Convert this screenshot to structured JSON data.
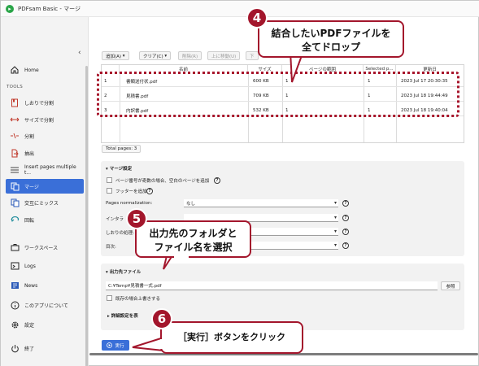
{
  "window": {
    "title": "PDFsam Basic - マージ"
  },
  "sidebar": {
    "home": "Home",
    "tools_header": "TOOLS",
    "items": [
      {
        "label": "しおりで分割",
        "icon": "split-bookmark-icon"
      },
      {
        "label": "サイズで分割",
        "icon": "split-size-icon"
      },
      {
        "label": "分割",
        "icon": "split-icon"
      },
      {
        "label": "抽出",
        "icon": "extract-icon"
      },
      {
        "label": "Insert pages multiple t...",
        "icon": "insert-pages-icon"
      },
      {
        "label": "マージ",
        "icon": "merge-icon"
      },
      {
        "label": "交互にミックス",
        "icon": "alternate-mix-icon"
      },
      {
        "label": "回転",
        "icon": "rotate-icon"
      }
    ],
    "bottom": [
      {
        "label": "ワークスペース",
        "icon": "briefcase-icon"
      },
      {
        "label": "Logs",
        "icon": "logs-icon"
      },
      {
        "label": "News",
        "icon": "news-icon"
      },
      {
        "label": "このアプリについて",
        "icon": "info-icon"
      },
      {
        "label": "設定",
        "icon": "gear-icon"
      },
      {
        "label": "終了",
        "icon": "power-icon"
      }
    ]
  },
  "toolbar": {
    "add": "追加(A)",
    "clear": "クリア(C)",
    "delete": "削除(R)",
    "move_up": "上に移動(U)",
    "move_down": "下"
  },
  "table": {
    "columns": [
      "名前",
      "サイズ",
      "ページの範囲",
      "Selected p...",
      "更新日"
    ],
    "rows": [
      {
        "num": "1",
        "name": "書類送付状.pdf",
        "size": "600 KB",
        "pages": "1",
        "selected": "1",
        "modified": "2023 Jul 17 20:30:35"
      },
      {
        "num": "2",
        "name": "見積書.pdf",
        "size": "709 KB",
        "pages": "1",
        "selected": "1",
        "modified": "2023 Jul 18 19:44:49"
      },
      {
        "num": "3",
        "name": "内訳書.pdf",
        "size": "532 KB",
        "pages": "1",
        "selected": "1",
        "modified": "2023 Jul 18 19:40:04"
      }
    ],
    "total": "Total pages: 3"
  },
  "merge_settings": {
    "title": "マージ設定",
    "odd_page_option": "ページ番号が奇数の場合、空白のページを追加",
    "footer_option": "フッターを追加",
    "pages_normalization_label": "Pages normalization:",
    "pages_normalization_value": "なし",
    "interactive_label": "インタラ",
    "bookmarks_label": "しおりの処理:",
    "toc_label": "目次:"
  },
  "output": {
    "title": "出力先ファイル",
    "path": "C:¥Temp¥見積書一式.pdf",
    "browse": "参照",
    "overwrite": "既存の場合上書きする",
    "advanced": "詳細設定を表"
  },
  "run_button": "実行",
  "callouts": {
    "c4_num": "4",
    "c4_text_1": "結合したいPDFファイルを",
    "c4_text_2": "全てドロップ",
    "c5_num": "5",
    "c5_text_1": "出力先のフォルダと",
    "c5_text_2": "ファイル名を選択",
    "c6_num": "6",
    "c6_text": "［実行］ボタンをクリック"
  },
  "colors": {
    "accent": "#3a6fd8",
    "callout": "#a3162c"
  }
}
